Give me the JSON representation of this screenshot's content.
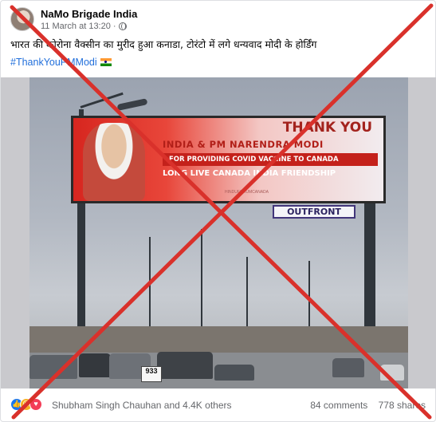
{
  "post": {
    "author": "NaMo Brigade India",
    "timestamp": "11 March at 13:20",
    "separator": "·",
    "caption": "भारत की कोरोना वैक्सीन का मुरीद हुआ कनाडा, टोरंटो में लगे धन्यवाद मोदी के होर्डिंग",
    "hashtag": "#ThankYouPMModi",
    "privacy_icon": "globe-icon",
    "flag_icon": "indian-flag-icon"
  },
  "billboard": {
    "thank_you": "THANK YOU",
    "line1": "INDIA & PM NARENDRA MODI",
    "line2": "FOR PROVIDING COVID VACCINE TO CANADA",
    "line3": "LONG LIVE CANADA INDIA FRIENDSHIP",
    "footer": "HINDUFORUMCANADA",
    "outfront": "OUTFRONT",
    "road_sign": "933"
  },
  "footer": {
    "reactions": [
      "like-icon",
      "haha-icon",
      "love-icon"
    ],
    "reactors": "Shubham Singh Chauhan and 4.4K others",
    "comments": "84 comments",
    "shares": "778 shares"
  },
  "colors": {
    "fact_check_cross": "#d9312b",
    "link": "#216fdb",
    "muted": "#65676b"
  }
}
